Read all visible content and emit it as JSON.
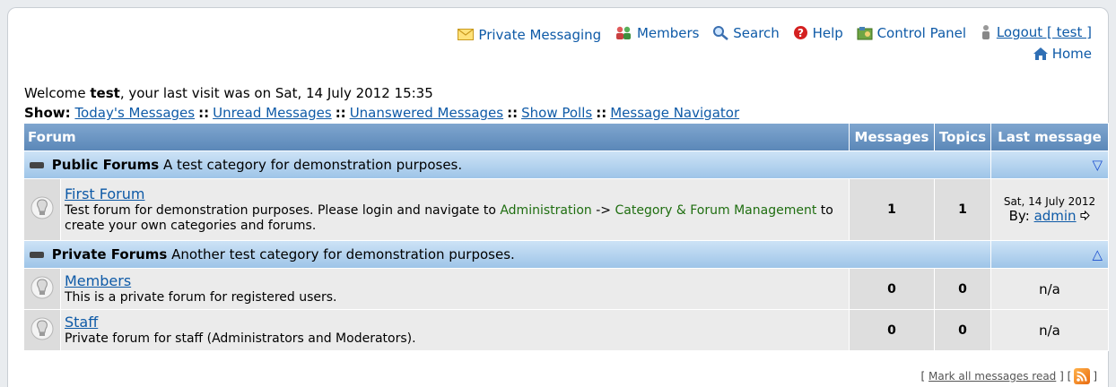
{
  "topnav": {
    "private_messaging": "Private Messaging",
    "members": "Members",
    "search": "Search",
    "help": "Help",
    "control_panel": "Control Panel",
    "logout": "Logout [ test ]",
    "home": "Home"
  },
  "welcome": {
    "prefix": "Welcome ",
    "user": "test",
    "suffix": ", your last visit was on Sat, 14 July 2012 15:35"
  },
  "show": {
    "label": "Show:",
    "sep": "::",
    "links": [
      "Today's Messages",
      "Unread Messages",
      "Unanswered Messages",
      "Show Polls",
      "Message Navigator"
    ]
  },
  "table": {
    "headers": {
      "forum": "Forum",
      "messages": "Messages",
      "topics": "Topics",
      "last": "Last message"
    },
    "categories": [
      {
        "name": "Public Forums",
        "description": "A test category for demonstration purposes.",
        "toggle": "▽",
        "forums": [
          {
            "title": "First Forum",
            "desc_a": "Test forum for demonstration purposes. Please login and navigate to ",
            "desc_link1": "Administration",
            "desc_b": " -> ",
            "desc_link2": "Category & Forum Management",
            "desc_c": " to create your own categories and forums.",
            "messages": "1",
            "topics": "1",
            "last_date": "Sat, 14 July 2012",
            "last_by_label": "By:",
            "last_by_user": "admin"
          }
        ]
      },
      {
        "name": "Private Forums",
        "description": "Another test category for demonstration purposes.",
        "toggle": "△",
        "forums": [
          {
            "title": "Members",
            "desc": "This is a private forum for registered users.",
            "messages": "0",
            "topics": "0",
            "last": "n/a"
          },
          {
            "title": "Staff",
            "desc": "Private forum for staff (Administrators and Moderators).",
            "messages": "0",
            "topics": "0",
            "last": "n/a"
          }
        ]
      }
    ]
  },
  "footer": {
    "bracket_open": "[",
    "mark_read": "Mark all messages read",
    "bracket_mid": "] [",
    "bracket_close": "]"
  },
  "icons": {
    "mail": "mail-icon",
    "members": "members-icon",
    "search": "search-icon",
    "help": "help-icon",
    "control_panel": "control-panel-icon",
    "logout": "logout-icon",
    "home": "home-icon",
    "bulb": "lightbulb-icon",
    "rss": "rss-icon"
  }
}
